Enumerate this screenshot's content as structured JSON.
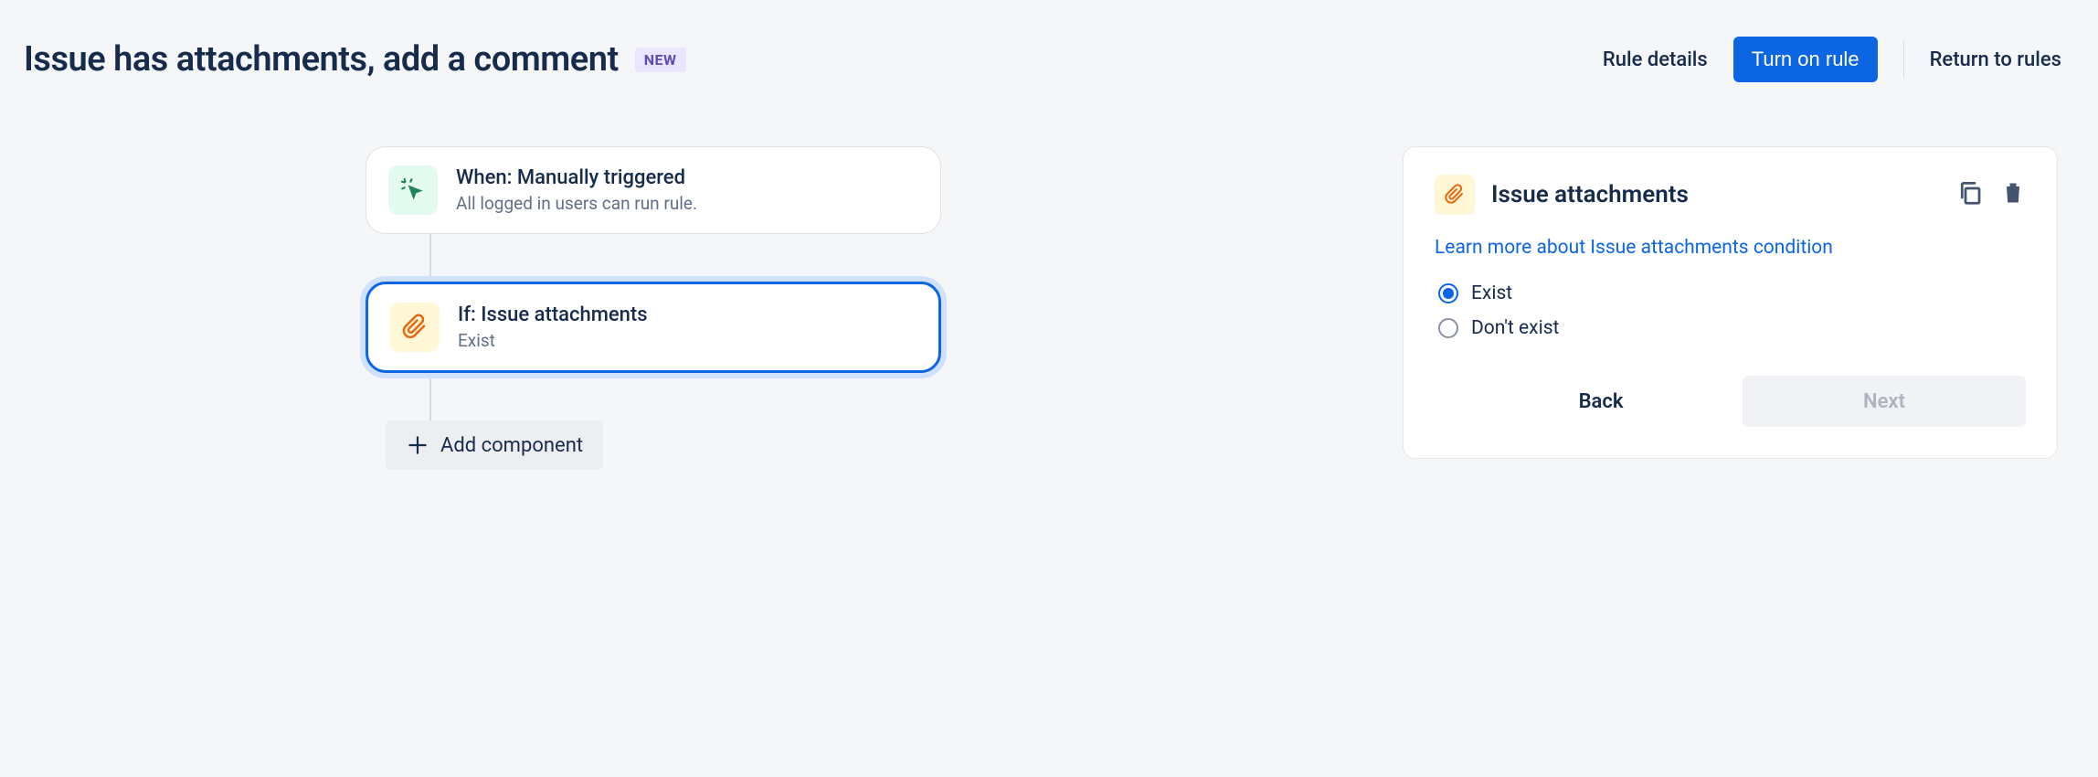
{
  "header": {
    "title": "Issue has attachments, add a comment",
    "badge": "NEW",
    "rule_details": "Rule details",
    "turn_on": "Turn on rule",
    "return": "Return to rules"
  },
  "flow": {
    "trigger": {
      "title": "When: Manually triggered",
      "subtitle": "All logged in users can run rule."
    },
    "condition": {
      "title": "If: Issue attachments",
      "subtitle": "Exist"
    },
    "add_label": "Add component"
  },
  "panel": {
    "title": "Issue attachments",
    "learn_link": "Learn more about Issue attachments condition",
    "options": {
      "exist": "Exist",
      "dont_exist": "Don't exist"
    },
    "buttons": {
      "back": "Back",
      "next": "Next"
    }
  }
}
